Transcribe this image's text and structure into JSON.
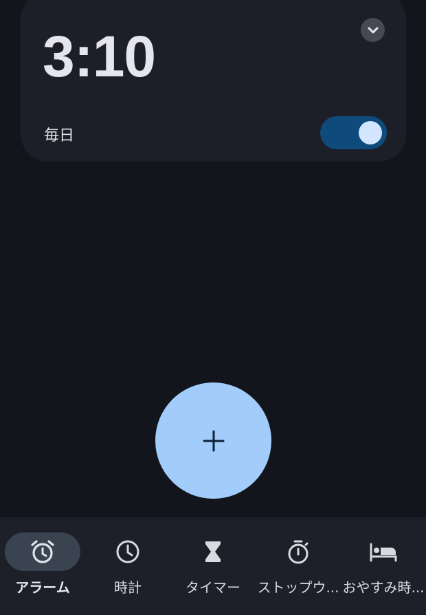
{
  "alarm": {
    "time": "3:10",
    "repeat": "毎日",
    "enabled": true
  },
  "fab": {
    "icon": "plus-icon"
  },
  "nav": {
    "items": [
      {
        "label": "アラーム",
        "icon": "alarm-icon",
        "active": true
      },
      {
        "label": "時計",
        "icon": "clock-icon",
        "active": false
      },
      {
        "label": "タイマー",
        "icon": "hourglass-icon",
        "active": false
      },
      {
        "label": "ストップウ...",
        "icon": "stopwatch-icon",
        "active": false
      },
      {
        "label": "おやすみ時...",
        "icon": "bed-icon",
        "active": false
      }
    ]
  },
  "colors": {
    "background": "#12151b",
    "card": "#1c1f27",
    "accent": "#a2cdfb",
    "toggle_track": "#0f4a7c",
    "toggle_knob": "#d3e5ff"
  }
}
